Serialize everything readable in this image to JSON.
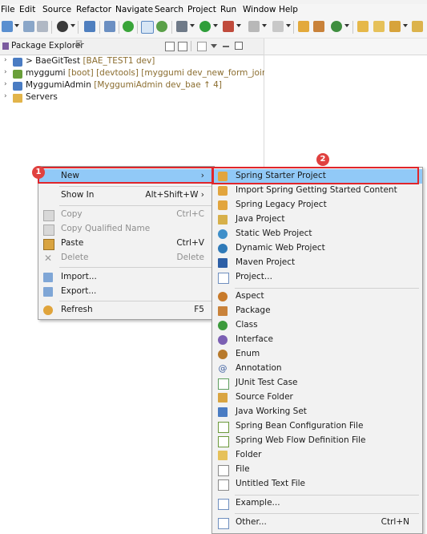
{
  "menubar": {
    "items": [
      "File",
      "Edit",
      "Source",
      "Refactor",
      "Navigate",
      "Search",
      "Project",
      "Run",
      "Window",
      "Help"
    ]
  },
  "view": {
    "title": "Package Explorer",
    "close_glyph": "☒"
  },
  "tree": [
    {
      "name": "> BaeGitTest",
      "decoration": "[BAE_TEST1 dev]",
      "icon": "git-project-icon"
    },
    {
      "name": "myggumi",
      "decoration": "[boot] [devtools] [myggumi dev_new_form_join]",
      "icon": "boot-project-icon"
    },
    {
      "name": "MyggumiAdmin",
      "decoration": "[MyggumiAdmin dev_bae ↑ 4]",
      "icon": "git-project-icon"
    },
    {
      "name": "Servers",
      "decoration": "",
      "icon": "folder-icon"
    }
  ],
  "context_menu": {
    "items": [
      {
        "label": "New",
        "shortcut": "›",
        "disabled": false,
        "selected": true
      },
      {
        "label": "Show In",
        "shortcut": "Alt+Shift+W ›",
        "disabled": false
      },
      {
        "label": "Copy",
        "shortcut": "Ctrl+C",
        "disabled": true
      },
      {
        "label": "Copy Qualified Name",
        "shortcut": "",
        "disabled": true
      },
      {
        "label": "Paste",
        "shortcut": "Ctrl+V",
        "disabled": false
      },
      {
        "label": "Delete",
        "shortcut": "Delete",
        "disabled": true
      },
      {
        "label": "Import...",
        "shortcut": "",
        "disabled": false
      },
      {
        "label": "Export...",
        "shortcut": "",
        "disabled": false
      },
      {
        "label": "Refresh",
        "shortcut": "F5",
        "disabled": false
      }
    ]
  },
  "submenu": {
    "items": [
      {
        "label": "Spring Starter Project",
        "icon": "spring-starter-icon",
        "selected": true
      },
      {
        "label": "Import Spring Getting Started Content",
        "icon": "spring-import-icon"
      },
      {
        "label": "Spring Legacy Project",
        "icon": "spring-legacy-icon"
      },
      {
        "label": "Java Project",
        "icon": "java-project-icon"
      },
      {
        "label": "Static Web Project",
        "icon": "static-web-icon"
      },
      {
        "label": "Dynamic Web Project",
        "icon": "dynamic-web-icon"
      },
      {
        "label": "Maven Project",
        "icon": "maven-icon"
      },
      {
        "label": "Project...",
        "icon": "project-icon"
      },
      {
        "label": "Aspect",
        "icon": "aspect-icon"
      },
      {
        "label": "Package",
        "icon": "package-icon"
      },
      {
        "label": "Class",
        "icon": "class-icon"
      },
      {
        "label": "Interface",
        "icon": "interface-icon"
      },
      {
        "label": "Enum",
        "icon": "enum-icon"
      },
      {
        "label": "Annotation",
        "icon": "annotation-icon"
      },
      {
        "label": "JUnit Test Case",
        "icon": "junit-icon"
      },
      {
        "label": "Source Folder",
        "icon": "source-folder-icon"
      },
      {
        "label": "Java Working Set",
        "icon": "working-set-icon"
      },
      {
        "label": "Spring Bean Configuration File",
        "icon": "spring-bean-icon"
      },
      {
        "label": "Spring Web Flow Definition File",
        "icon": "web-flow-icon"
      },
      {
        "label": "Folder",
        "icon": "folder-icon"
      },
      {
        "label": "File",
        "icon": "file-icon"
      },
      {
        "label": "Untitled Text File",
        "icon": "text-file-icon"
      },
      {
        "label": "Example...",
        "icon": "example-icon"
      },
      {
        "label": "Other...",
        "icon": "other-icon",
        "shortcut": "Ctrl+N"
      }
    ]
  },
  "annotations": {
    "badge_1": "1",
    "badge_2": "2",
    "highlight_color": "#e0252b"
  },
  "colors": {
    "selection": "#91c9f7",
    "decoration": "#8b6d2f",
    "disabled": "#8e8e8e"
  }
}
